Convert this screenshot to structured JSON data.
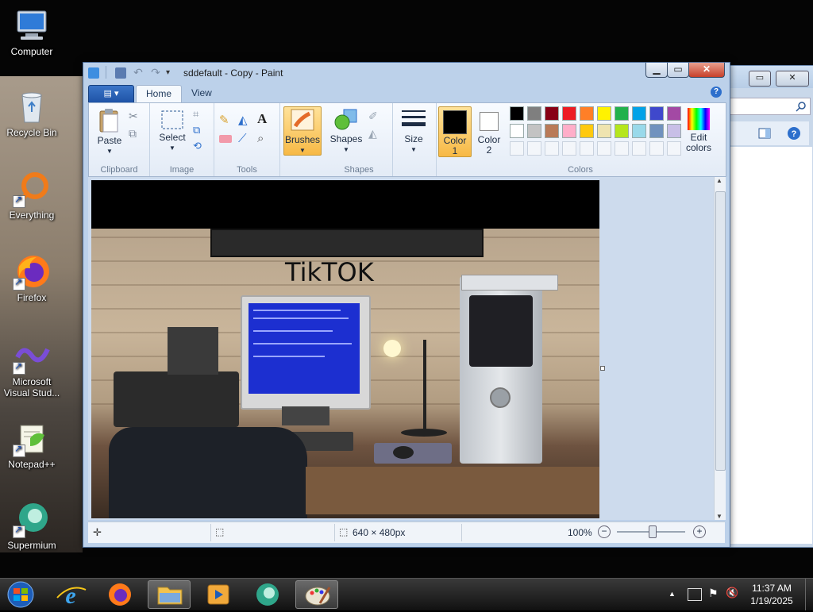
{
  "desktop": {
    "icons": [
      {
        "label": "Computer",
        "icon": "computer-icon"
      },
      {
        "label": "Recycle Bin",
        "icon": "recycle-bin-icon"
      },
      {
        "label": "Everything",
        "icon": "everything-icon"
      },
      {
        "label": "Firefox",
        "icon": "firefox-icon"
      },
      {
        "label": "Microsoft Visual Stud...",
        "icon": "visual-studio-icon"
      },
      {
        "label": "Notepad++",
        "icon": "notepad-plus-plus-icon"
      },
      {
        "label": "Supermium",
        "icon": "supermium-icon"
      }
    ]
  },
  "explorer_window": {
    "buttons": [
      "▭",
      "✕"
    ]
  },
  "paint": {
    "title": "sddefault - Copy - Paint",
    "window_buttons": {
      "minimize": "▁",
      "maximize": "▭",
      "close": "✕"
    },
    "tabs": {
      "file": "▤ ▾",
      "home": "Home",
      "view": "View",
      "help": "?"
    },
    "clipboard": {
      "paste": "Paste",
      "label": "Clipboard"
    },
    "image": {
      "select": "Select",
      "label": "Image"
    },
    "tools": {
      "label": "Tools",
      "text_glyph": "A"
    },
    "brushes": {
      "label": "Brushes"
    },
    "shapes": {
      "label": "Shapes",
      "group_label": "Shapes"
    },
    "size": {
      "label": "Size"
    },
    "colors": {
      "color1_line1": "Color",
      "color1_line2": "1",
      "color2_line1": "Color",
      "color2_line2": "2",
      "edit_line1": "Edit",
      "edit_line2": "colors",
      "group_label": "Colors",
      "color1_value": "#000000",
      "color2_value": "#ffffff",
      "palette_row1": [
        "#000000",
        "#7f7f7f",
        "#880015",
        "#ed1c24",
        "#ff7f27",
        "#fff200",
        "#22b14c",
        "#00a2e8",
        "#3f48cc",
        "#a349a4"
      ],
      "palette_row2": [
        "#ffffff",
        "#c3c3c3",
        "#b97a57",
        "#ffaec9",
        "#ffc90e",
        "#efe4b0",
        "#b5e61d",
        "#99d9ea",
        "#7092be",
        "#c8bfe7"
      ]
    },
    "canvas_text": "TikTOK",
    "status": {
      "dimensions": "640 × 480px",
      "zoom": "100%",
      "zoom_out": "−",
      "zoom_in": "+"
    }
  },
  "taskbar": {
    "time": "11:37 AM",
    "date": "1/19/2025",
    "tray_arrow": "▲"
  }
}
